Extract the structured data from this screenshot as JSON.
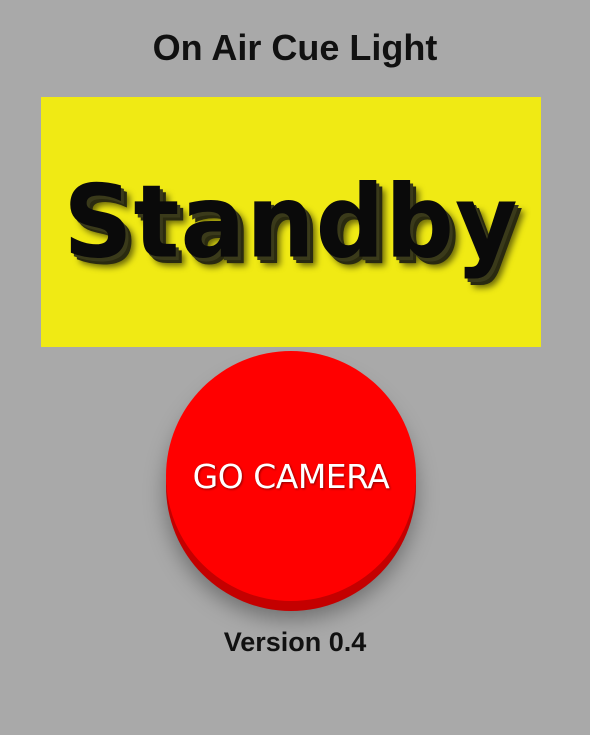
{
  "app": {
    "title": "On Air Cue Light",
    "version_label": "Version 0.4"
  },
  "status_panel": {
    "text": "Standby",
    "background_color": "#f0ea14",
    "text_color": "#0a0a0a"
  },
  "go_button": {
    "label": "GO CAMERA",
    "color": "#ff0000",
    "shadow_color": "#c40000",
    "label_color": "#ffffff"
  },
  "page": {
    "background_color": "#a9a9a9"
  }
}
